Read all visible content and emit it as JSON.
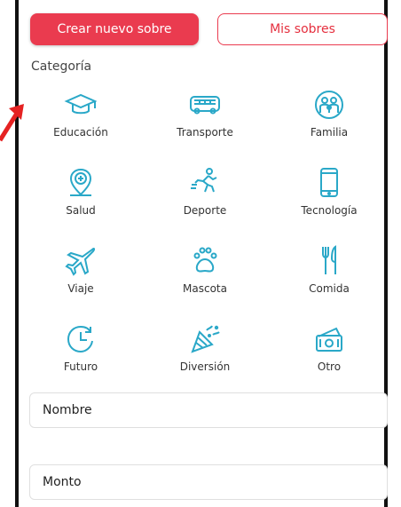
{
  "header": {
    "create_label": "Crear nuevo sobre",
    "my_envelopes_label": "Mis sobres"
  },
  "category_title": "Categoría",
  "categories": [
    {
      "label": "Educación",
      "icon": "graduation-cap-icon"
    },
    {
      "label": "Transporte",
      "icon": "bus-icon"
    },
    {
      "label": "Familia",
      "icon": "family-icon"
    },
    {
      "label": "Salud",
      "icon": "health-pin-icon"
    },
    {
      "label": "Deporte",
      "icon": "runner-icon"
    },
    {
      "label": "Tecnología",
      "icon": "smartphone-icon"
    },
    {
      "label": "Viaje",
      "icon": "airplane-icon"
    },
    {
      "label": "Mascota",
      "icon": "paw-icon"
    },
    {
      "label": "Comida",
      "icon": "fork-knife-icon"
    },
    {
      "label": "Futuro",
      "icon": "clock-history-icon"
    },
    {
      "label": "Diversión",
      "icon": "party-popper-icon"
    },
    {
      "label": "Otro",
      "icon": "money-icon"
    }
  ],
  "fields": {
    "name_label": "Nombre",
    "amount_label": "Monto"
  },
  "colors": {
    "accent": "#ea3b4f",
    "icon": "#2aa8c8"
  }
}
